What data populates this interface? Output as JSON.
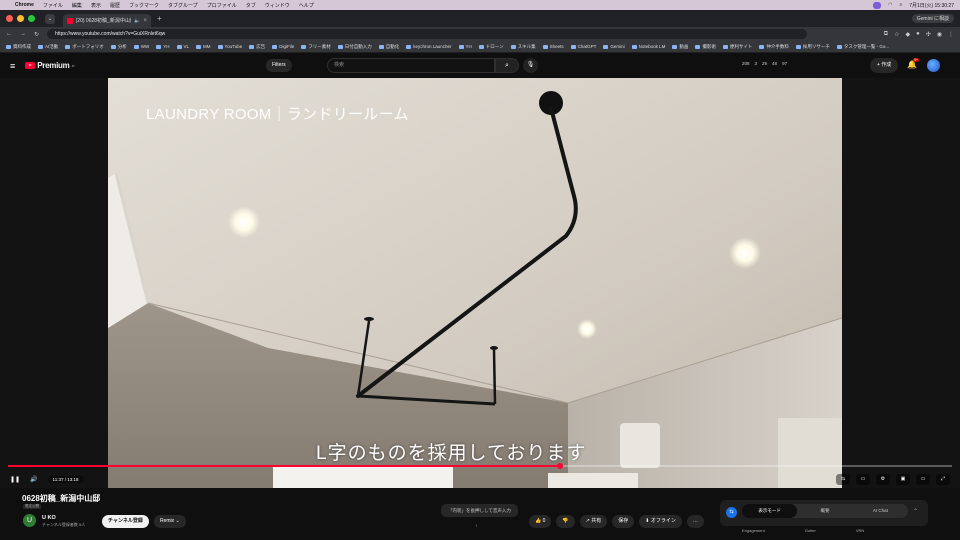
{
  "menubar": {
    "apple": "",
    "app": "Chrome",
    "items": [
      "ファイル",
      "編集",
      "表示",
      "履歴",
      "ブックマーク",
      "タブグループ",
      "プロファイル",
      "タブ",
      "ウィンドウ",
      "ヘルプ"
    ],
    "pill": "",
    "date_time": "7月1日(火) 15:30:27"
  },
  "tabs": {
    "active_title": "(20) 0628初稿_新潟中山邸",
    "gemini": "Gemini に相談"
  },
  "address": {
    "url": "https://www.youtube.com/watch?v=GuiXRnlet6qw"
  },
  "bookmarks": [
    "資料作成",
    "AI活動",
    "ポートフォリオ",
    "分析",
    "WW",
    "YH",
    "VL",
    "MM",
    "YouTube",
    "広告",
    "DigiFile",
    "フリー素材",
    "日付自動入力",
    "自動化",
    "keychron Launcher",
    "YH",
    "ドローン",
    "スキル集",
    "Sheets",
    "ChatGPT",
    "Gemini",
    "Notebook LM",
    "動画",
    "撮影術",
    "便利サイト",
    "仲介手数料",
    "採用リサーチ",
    "タスク管理一覧 - Go..."
  ],
  "yt": {
    "logo_text": "Premium",
    "logo_sup": "JP",
    "filters": "Filters",
    "search_placeholder": "検索",
    "stats": [
      "208",
      "3",
      "29",
      "48",
      "97"
    ],
    "create": "+ 作成",
    "notif": "9+"
  },
  "video": {
    "overlay_title": "LAUNDRY ROOM｜ランドリールーム",
    "subtitle": "L字のものを採用しております",
    "time": "11:37 / 13:18",
    "progress": 0.585
  },
  "below": {
    "title": "0628初稿_新潟中山邸",
    "badge": "限定公開",
    "channel_initial": "U",
    "channel_name": "U KO",
    "subscribers": "チャンネル登録者数 5人",
    "subscribe": "チャンネル登録",
    "remix": "Remix",
    "hint": "「内装」を長押しして音声入力",
    "hint2": "↑",
    "actions": [
      "👍 0",
      "👎",
      "↗ 共有",
      "保存",
      "⬇ オフライン",
      "…"
    ],
    "modes": [
      "表示モード",
      "概要",
      "AI Chat"
    ],
    "mode_foot": [
      "Engagement",
      "Gutter",
      "VRN"
    ]
  },
  "colors": {
    "yt_red": "#ff0033",
    "bg": "#0f0f0f"
  }
}
